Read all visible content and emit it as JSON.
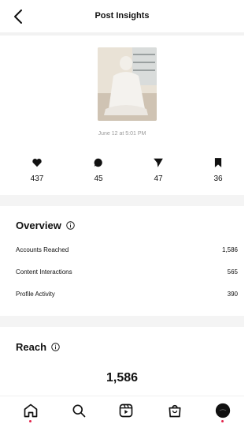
{
  "header": {
    "title": "Post Insights"
  },
  "post": {
    "date": "June 12 at 5:01 PM"
  },
  "stats": [
    {
      "icon": "heart-icon",
      "value": "437"
    },
    {
      "icon": "comment-icon",
      "value": "45"
    },
    {
      "icon": "share-icon",
      "value": "47"
    },
    {
      "icon": "bookmark-icon",
      "value": "36"
    }
  ],
  "overview": {
    "title": "Overview",
    "rows": [
      {
        "label": "Accounts Reached",
        "value": "1,586"
      },
      {
        "label": "Content Interactions",
        "value": "565"
      },
      {
        "label": "Profile Activity",
        "value": "390"
      }
    ]
  },
  "reach": {
    "title": "Reach",
    "value": "1,586"
  },
  "colors": {
    "notification_dot": "#e2244b"
  }
}
